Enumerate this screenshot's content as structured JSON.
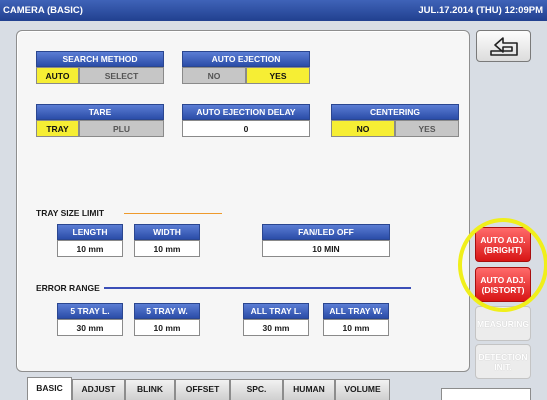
{
  "titlebar": {
    "title": "CAMERA (BASIC)",
    "datetime": "JUL.17.2014 (THU) 12:09PM"
  },
  "search_method": {
    "label": "SEARCH METHOD",
    "options": [
      "AUTO",
      "SELECT"
    ],
    "selected": "AUTO"
  },
  "auto_ejection": {
    "label": "AUTO EJECTION",
    "options": [
      "NO",
      "YES"
    ],
    "selected": "YES"
  },
  "tare": {
    "label": "TARE",
    "options": [
      "TRAY",
      "PLU"
    ],
    "selected": "TRAY"
  },
  "auto_ejection_delay": {
    "label": "AUTO EJECTION DELAY",
    "value": "0"
  },
  "centering": {
    "label": "CENTERING",
    "options": [
      "NO",
      "YES"
    ],
    "selected": "NO"
  },
  "tray_size_limit": {
    "label": "TRAY SIZE LIMIT",
    "length": {
      "label": "LENGTH",
      "value": "10 mm"
    },
    "width": {
      "label": "WIDTH",
      "value": "10 mm"
    },
    "fan_led_off": {
      "label": "FAN/LED OFF",
      "value": "10 MIN"
    }
  },
  "error_range": {
    "label": "ERROR RANGE",
    "fields": [
      {
        "label": "5 TRAY L.",
        "value": "30 mm"
      },
      {
        "label": "5 TRAY W.",
        "value": "10 mm"
      },
      {
        "label": "ALL TRAY L.",
        "value": "30 mm"
      },
      {
        "label": "ALL TRAY W.",
        "value": "10 mm"
      }
    ]
  },
  "side_buttons": {
    "back_icon": "return-arrow-icon",
    "auto_adj_bright": {
      "line1": "AUTO ADJ.",
      "line2": "(BRIGHT)"
    },
    "auto_adj_distort": {
      "line1": "AUTO ADJ.",
      "line2": "(DISTORT)"
    },
    "measuring": "MEASURING",
    "detection_init": {
      "line1": "DETECTION",
      "line2": "INIT."
    }
  },
  "tabs": [
    "BASIC",
    "ADJUST",
    "BLINK",
    "OFFSET",
    "SPC.",
    "HUMAN",
    "VOLUME"
  ],
  "active_tab": "BASIC",
  "colors": {
    "titlebar": "#2a4aa0",
    "group_header": "#3a5cc0",
    "selected_option": "#f6ee34",
    "auto_adj_button": "#e02020",
    "highlight_ring": "#f0ef1a"
  }
}
